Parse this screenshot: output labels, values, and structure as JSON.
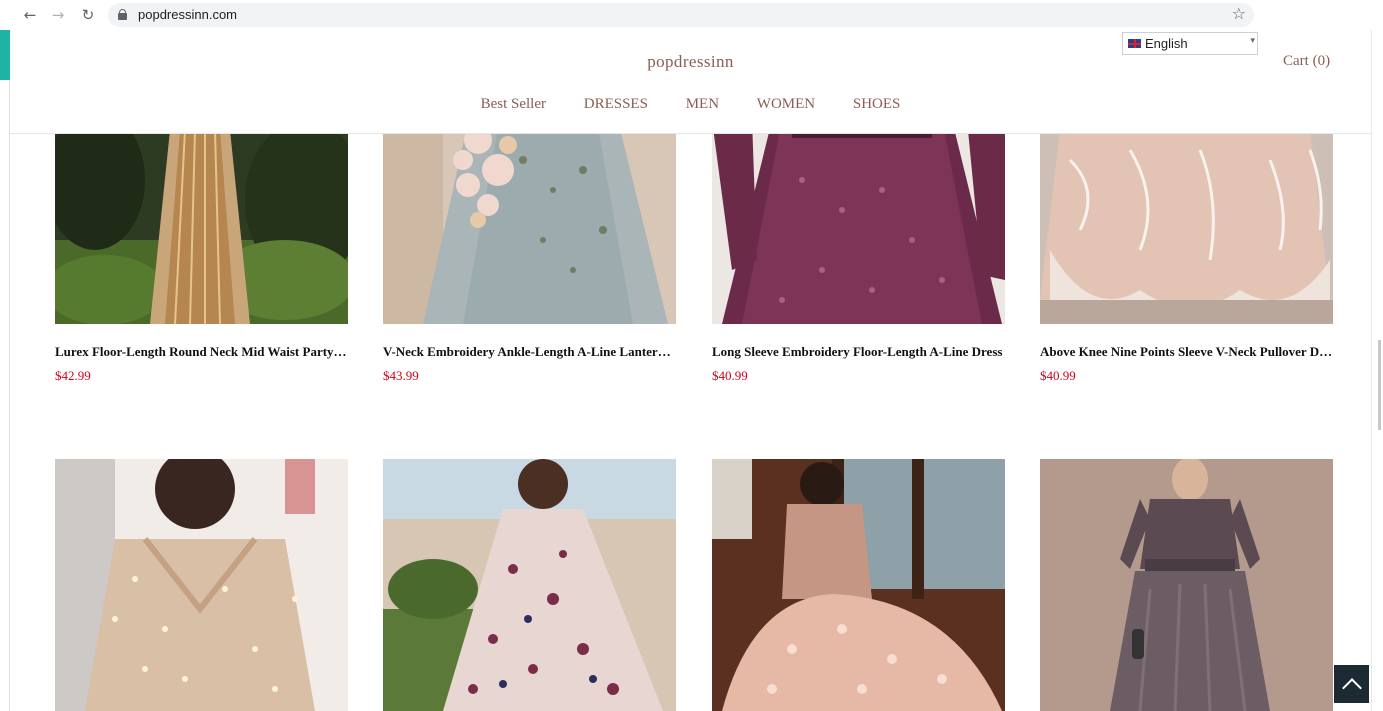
{
  "browser": {
    "url": "popdressinn.com",
    "back_icon": "arrow-left",
    "forward_icon": "arrow-right",
    "reload_icon": "reload",
    "bookmark_icon": "star-outline"
  },
  "header": {
    "logo": "popdressinn",
    "language": "English",
    "cart": "Cart (0)",
    "menu": [
      "Best Seller",
      "DRESSES",
      "MEN",
      "WOMEN",
      "SHOES"
    ]
  },
  "colors": {
    "brand": "#8b5e52",
    "price": "#d0021b",
    "accent": "#1fb3a5"
  },
  "products_row1": [
    {
      "title": "Lurex Floor-Length Round Neck Mid Waist Party Dress",
      "price": "$42.99",
      "image": "gold-lurex-gown-garden"
    },
    {
      "title": "V-Neck Embroidery Ankle-Length A-Line Lantern Sleeve Dress",
      "price": "$43.99",
      "image": "pale-blue-tulle-gown-with-bouquet"
    },
    {
      "title": "Long Sleeve Embroidery Floor-Length A-Line Dress",
      "price": "$40.99",
      "image": "purple-beaded-lace-gown"
    },
    {
      "title": "Above Knee Nine Points Sleeve V-Neck Pullover Dress",
      "price": "$40.99",
      "image": "pink-lace-short-dress"
    }
  ],
  "products_row2": [
    {
      "image": "champagne-sequin-wrap-dress"
    },
    {
      "image": "floral-embroidered-backless-ball-gown"
    },
    {
      "image": "blush-lace-ball-gown-by-window"
    },
    {
      "image": "grey-lace-ruffle-gown"
    }
  ]
}
